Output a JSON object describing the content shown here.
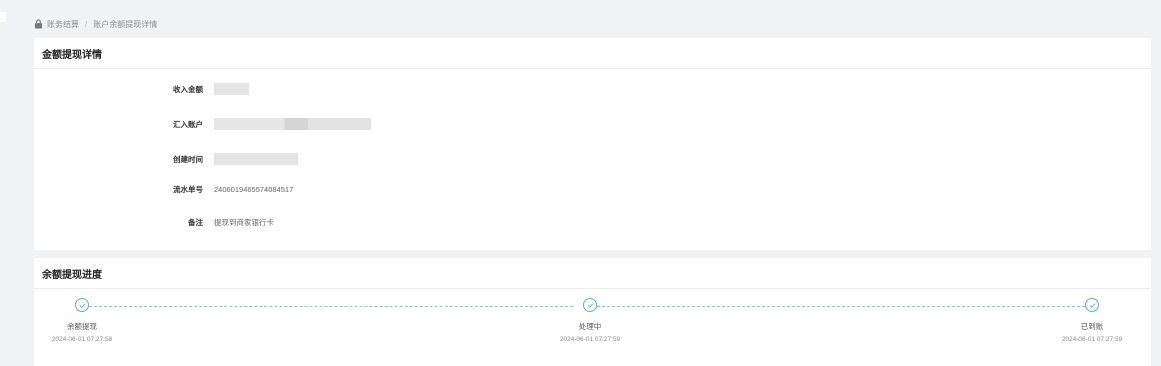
{
  "breadcrumb": {
    "root": "账务结算",
    "separator": "/",
    "current": "账户余额提现详情"
  },
  "detail": {
    "title": "金额提现详情",
    "fields": {
      "income_amount": {
        "label": "收入金额"
      },
      "account": {
        "label": "汇入账户"
      },
      "created_time": {
        "label": "创建时间"
      },
      "serial_no": {
        "label": "流水单号",
        "value": "2406019465574084517"
      },
      "remark": {
        "label": "备注",
        "value": "提现到商家银行卡"
      }
    }
  },
  "progress": {
    "title": "余额提现进度",
    "steps": [
      {
        "name": "余额提现",
        "time": "2024-06-01 07:27:58",
        "icon": "check-icon"
      },
      {
        "name": "处理中",
        "time": "2024-06-01 07:27:59",
        "icon": "check-icon"
      },
      {
        "name": "已到账",
        "time": "2024-06-01 07:27:59",
        "icon": "check-icon"
      }
    ],
    "accent": "#4fb1e0"
  }
}
